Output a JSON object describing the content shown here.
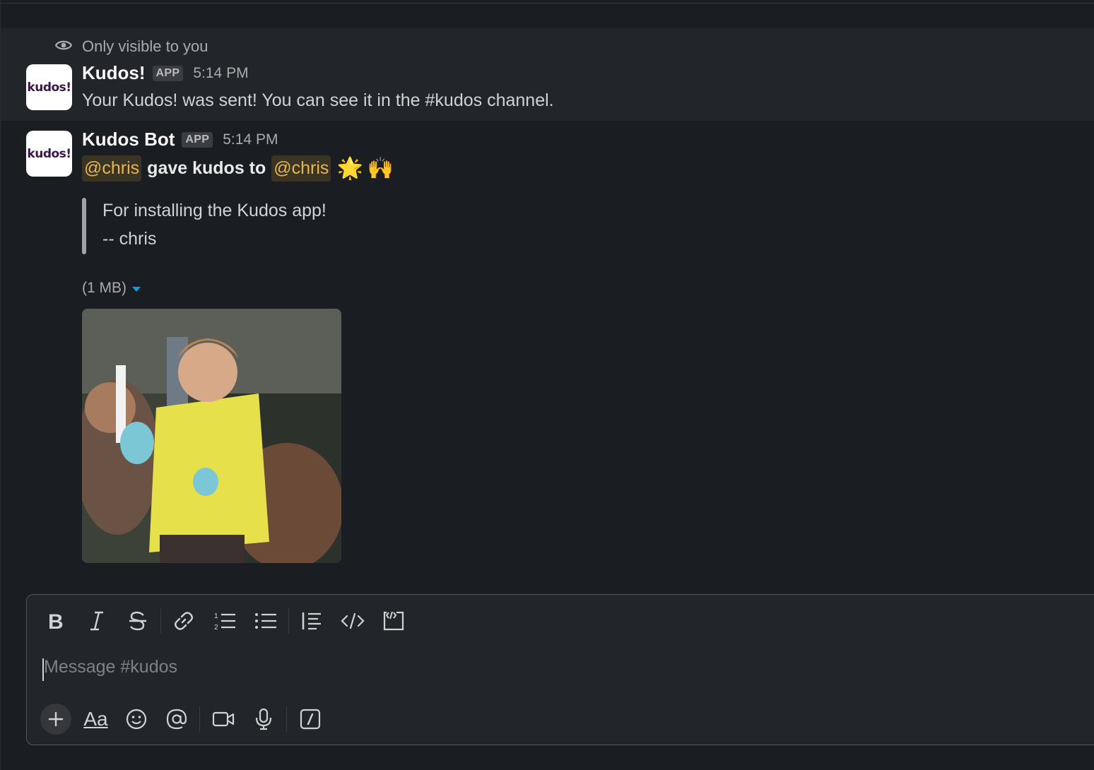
{
  "ephemeral_notice": "Only visible to you",
  "message1": {
    "sender": "Kudos!",
    "badge": "APP",
    "time": "5:14 PM",
    "avatar_text": "kudos!",
    "text": "Your Kudos! was sent! You can see it in the #kudos channel."
  },
  "message2": {
    "sender": "Kudos Bot",
    "badge": "APP",
    "time": "5:14 PM",
    "avatar_text": "kudos!",
    "mention_from": "@chris",
    "action": "gave kudos to",
    "mention_to": "@chris",
    "emoji1": "🌟",
    "emoji2": "🙌",
    "quote_line1": "For installing the Kudos app!",
    "quote_line2": "-- chris",
    "file_size": "(1 MB)"
  },
  "composer": {
    "placeholder": "Message #kudos",
    "text_format_label": "Aa"
  },
  "colors": {
    "background": "#1a1d21",
    "mention_text": "#e8b64c",
    "mention_bg": "#3a3425",
    "accent_caret": "#1d9bd1"
  },
  "icons": {
    "toolbar": [
      "bold-icon",
      "italic-icon",
      "strikethrough-icon",
      "link-icon",
      "ordered-list-icon",
      "bulleted-list-icon",
      "blockquote-icon",
      "code-icon",
      "code-block-icon"
    ],
    "bottombar": [
      "plus-icon",
      "text-format-icon",
      "emoji-icon",
      "mention-icon",
      "video-icon",
      "microphone-icon",
      "slash-command-icon"
    ]
  }
}
